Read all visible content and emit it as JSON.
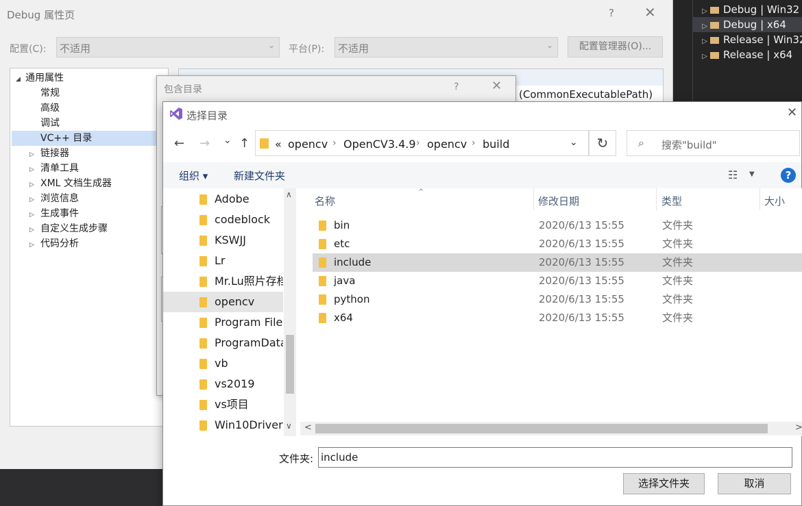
{
  "solution_explorer": {
    "items": [
      {
        "label": "Debug | Win32",
        "selected": false
      },
      {
        "label": "Debug | x64",
        "selected": true
      },
      {
        "label": "Release | Win32",
        "selected": false
      },
      {
        "label": "Release | x64",
        "selected": false
      }
    ]
  },
  "property_dialog": {
    "title": "Debug 属性页",
    "help": "?",
    "close": "✕",
    "config_label": "配置(C):",
    "config_value": "不适用",
    "platform_label": "平台(P):",
    "platform_value": "不适用",
    "config_manager_button": "配置管理器(O)...",
    "tree": [
      {
        "label": "通用属性",
        "expand": "◢",
        "level": 0
      },
      {
        "label": "常规",
        "expand": "",
        "level": 1
      },
      {
        "label": "高级",
        "expand": "",
        "level": 1
      },
      {
        "label": "调试",
        "expand": "",
        "level": 1
      },
      {
        "label": "VC++ 目录",
        "expand": "",
        "level": 1,
        "selected": true
      },
      {
        "label": "链接器",
        "expand": "▷",
        "level": 1
      },
      {
        "label": "清单工具",
        "expand": "▷",
        "level": 1
      },
      {
        "label": "XML 文档生成器",
        "expand": "▷",
        "level": 1
      },
      {
        "label": "浏览信息",
        "expand": "▷",
        "level": 1
      },
      {
        "label": "生成事件",
        "expand": "▷",
        "level": 1
      },
      {
        "label": "自定义生成步骤",
        "expand": "▷",
        "level": 1
      },
      {
        "label": "代码分析",
        "expand": "▷",
        "level": 1
      }
    ],
    "partial_value": "(CommonExecutablePath)"
  },
  "include_dialog": {
    "title": "包含目录",
    "help": "?",
    "close": "✕"
  },
  "select_folder_dialog": {
    "title": "选择目录",
    "close": "✕",
    "nav": {
      "back": "←",
      "forward": "→",
      "recent": "⌄",
      "up": "↑"
    },
    "breadcrumbs": [
      "«",
      "opencv",
      "OpenCV3.4.9",
      "opencv",
      "build"
    ],
    "crumb_sep": "›",
    "refresh": "↻",
    "search_placeholder": "搜索\"build\"",
    "organize": "组织 ▾",
    "new_folder": "新建文件夹",
    "help": "?",
    "nav_items": [
      {
        "label": "Adobe",
        "selected": false
      },
      {
        "label": "codeblock",
        "selected": false
      },
      {
        "label": "KSWJJ",
        "selected": false
      },
      {
        "label": "Lr",
        "selected": false
      },
      {
        "label": "Mr.Lu照片存档",
        "selected": false
      },
      {
        "label": "opencv",
        "selected": true
      },
      {
        "label": "Program Files",
        "selected": false
      },
      {
        "label": "ProgramData",
        "selected": false
      },
      {
        "label": "vb",
        "selected": false
      },
      {
        "label": "vs2019",
        "selected": false
      },
      {
        "label": "vs项目",
        "selected": false
      },
      {
        "label": "Win10Driver",
        "selected": false
      }
    ],
    "columns": {
      "name": "名称",
      "date": "修改日期",
      "type": "类型",
      "size": "大小"
    },
    "files": [
      {
        "name": "bin",
        "date": "2020/6/13 15:55",
        "type": "文件夹",
        "selected": false
      },
      {
        "name": "etc",
        "date": "2020/6/13 15:55",
        "type": "文件夹",
        "selected": false
      },
      {
        "name": "include",
        "date": "2020/6/13 15:55",
        "type": "文件夹",
        "selected": true
      },
      {
        "name": "java",
        "date": "2020/6/13 15:55",
        "type": "文件夹",
        "selected": false
      },
      {
        "name": "python",
        "date": "2020/6/13 15:55",
        "type": "文件夹",
        "selected": false
      },
      {
        "name": "x64",
        "date": "2020/6/13 15:55",
        "type": "文件夹",
        "selected": false
      }
    ],
    "folder_label": "文件夹:",
    "folder_value": "include",
    "select_button": "选择文件夹",
    "cancel_button": "取消"
  },
  "colors": {
    "accent": "#1f6fcf",
    "folder": "#f5c040",
    "vs_purple": "#865fc5",
    "dark_bg": "#2d2d30"
  }
}
